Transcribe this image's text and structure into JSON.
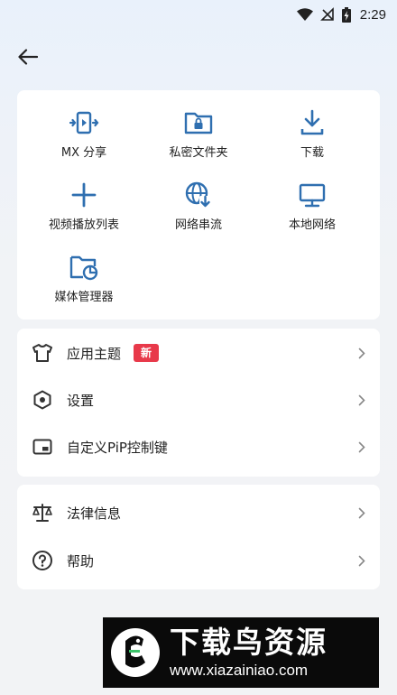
{
  "status_bar": {
    "time": "2:29",
    "icons": [
      "wifi-icon",
      "no-signal-icon",
      "battery-charging-icon"
    ]
  },
  "toolbar": {
    "back_icon": "arrow-left-icon"
  },
  "grid": {
    "items": [
      {
        "label": "MX 分享",
        "icon": "mx-share-icon"
      },
      {
        "label": "私密文件夹",
        "icon": "private-folder-icon"
      },
      {
        "label": "下载",
        "icon": "download-icon"
      },
      {
        "label": "视频播放列表",
        "icon": "plus-icon"
      },
      {
        "label": "网络串流",
        "icon": "network-stream-icon"
      },
      {
        "label": "本地网络",
        "icon": "monitor-icon"
      },
      {
        "label": "媒体管理器",
        "icon": "media-manager-icon"
      }
    ]
  },
  "settings_list": {
    "items": [
      {
        "label": "应用主题",
        "badge": "新",
        "icon": "tshirt-icon"
      },
      {
        "label": "设置",
        "icon": "hexagon-settings-icon"
      },
      {
        "label": "自定义PiP控制键",
        "icon": "pip-icon"
      }
    ]
  },
  "info_list": {
    "items": [
      {
        "label": "法律信息",
        "icon": "scale-icon"
      },
      {
        "label": "帮助",
        "icon": "help-icon"
      }
    ]
  },
  "watermark": {
    "title": "下载鸟资源",
    "url": "www.xiazainiao.com"
  },
  "colors": {
    "accent": "#2f6fb0",
    "badge": "#e8394a",
    "icon_dark": "#333333"
  }
}
